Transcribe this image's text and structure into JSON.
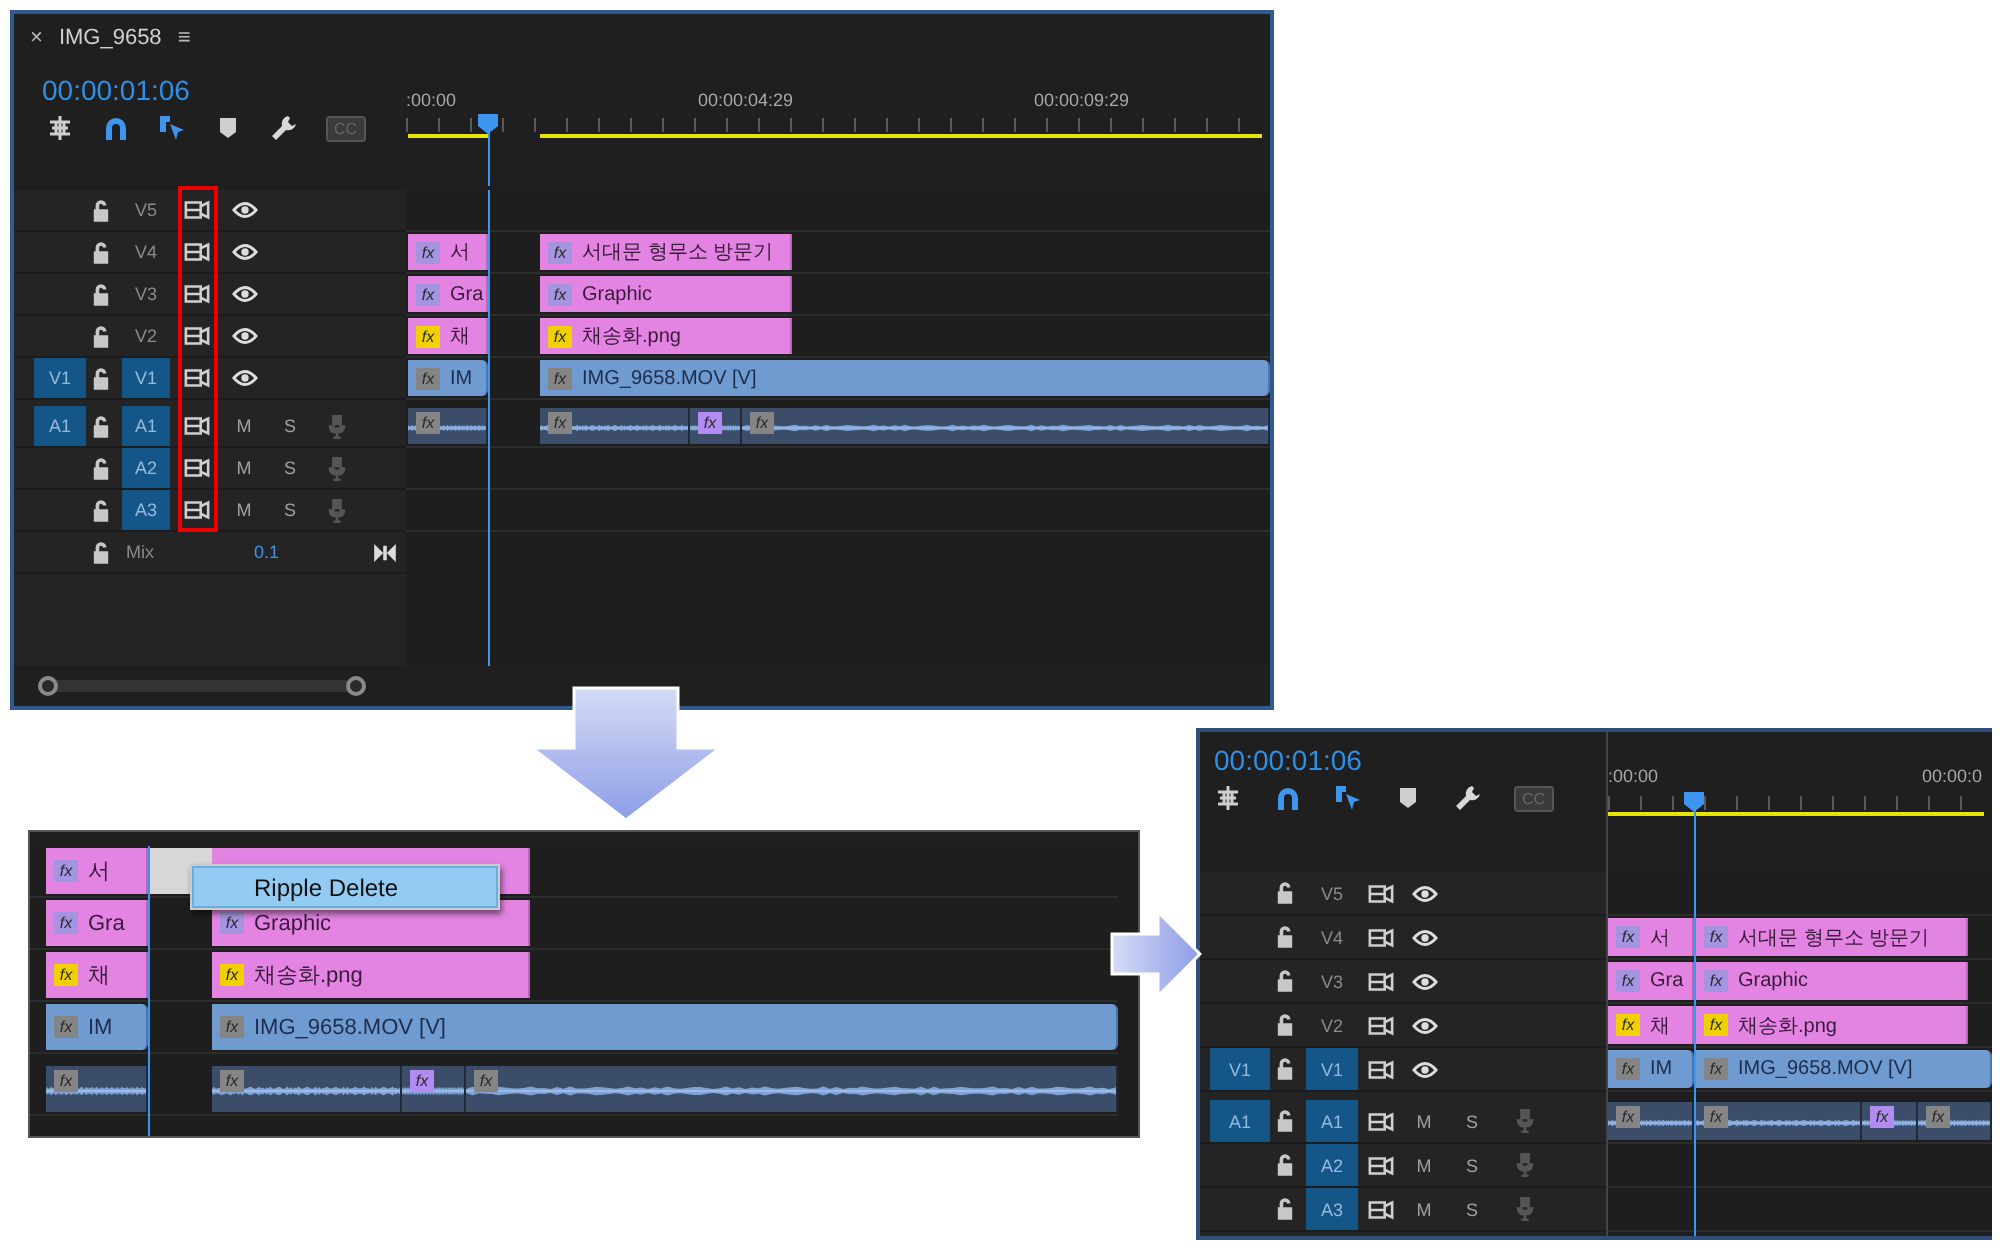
{
  "before": {
    "tab": {
      "close": "×",
      "title": "IMG_9658",
      "menu": "≡"
    },
    "timecode": "00:00:01:06",
    "captions": "CC",
    "ruler": [
      ":00:00",
      "00:00:04:29",
      "00:00:09:29"
    ],
    "tracks": [
      {
        "name": "V5",
        "kind": "video",
        "targeted": false
      },
      {
        "name": "V4",
        "kind": "video",
        "targeted": false,
        "clips": [
          {
            "kind": "graphic",
            "badge": "fx",
            "color": "#a595e0",
            "label": "서"
          },
          {
            "kind": "graphic",
            "badge": "fx",
            "color": "#a595e0",
            "label": "서대문 형무소 방문기"
          }
        ]
      },
      {
        "name": "V3",
        "kind": "video",
        "targeted": false,
        "clips": [
          {
            "kind": "graphic",
            "badge": "fx",
            "color": "#a595e0",
            "label": "Gra"
          },
          {
            "kind": "graphic",
            "badge": "fx",
            "color": "#a595e0",
            "label": "Graphic"
          }
        ]
      },
      {
        "name": "V2",
        "kind": "video",
        "targeted": false,
        "clips": [
          {
            "kind": "graphic",
            "badge": "fx",
            "color": "#f0d000",
            "label": "채"
          },
          {
            "kind": "graphic",
            "badge": "fx",
            "color": "#f0d000",
            "label": "채송화.png"
          }
        ]
      },
      {
        "name": "V1",
        "kind": "video",
        "source": "V1",
        "targeted": true,
        "clips": [
          {
            "kind": "video",
            "badge": "fx",
            "color": "#858585",
            "label": "IM"
          },
          {
            "kind": "video",
            "badge": "fx",
            "color": "#858585",
            "label": "IMG_9658.MOV [V]"
          }
        ]
      },
      {
        "name": "A1",
        "kind": "audio",
        "source": "A1",
        "targeted": true,
        "mute": "M",
        "solo": "S",
        "clips": [
          {
            "kind": "audio",
            "badge": "fx",
            "color": "#858585"
          },
          {
            "kind": "audio",
            "badge": "fx",
            "color": "#858585"
          },
          {
            "kind": "audio",
            "badge": "fx",
            "color": "#b28cf0"
          },
          {
            "kind": "audio",
            "badge": "fx",
            "color": "#858585"
          }
        ]
      },
      {
        "name": "A2",
        "kind": "audio",
        "targeted": true,
        "mute": "M",
        "solo": "S"
      },
      {
        "name": "A3",
        "kind": "audio",
        "targeted": true,
        "mute": "M",
        "solo": "S"
      }
    ],
    "mix": {
      "label": "Mix",
      "value": "0.1"
    }
  },
  "edit": {
    "tracks": [
      {
        "gap_selected": true,
        "clips": [
          {
            "kind": "graphic",
            "badge": "fx",
            "color": "#a595e0",
            "label": "서"
          },
          {
            "kind": "graphic"
          }
        ]
      },
      {
        "gap_selected": false,
        "clips": [
          {
            "kind": "graphic",
            "badge": "fx",
            "color": "#a595e0",
            "label": "Gra"
          },
          {
            "kind": "graphic",
            "badge": "fx",
            "color": "#a595e0",
            "label": "Graphic"
          }
        ]
      },
      {
        "gap_selected": false,
        "clips": [
          {
            "kind": "graphic",
            "badge": "fx",
            "color": "#f0d000",
            "label": "채"
          },
          {
            "kind": "graphic",
            "badge": "fx",
            "color": "#f0d000",
            "label": "채송화.png"
          }
        ]
      },
      {
        "gap_selected": false,
        "clips": [
          {
            "kind": "video",
            "badge": "fx",
            "color": "#858585",
            "label": "IM"
          },
          {
            "kind": "video",
            "badge": "fx",
            "color": "#858585",
            "label": "IMG_9658.MOV [V]"
          }
        ]
      },
      {
        "gap_selected": false,
        "clips": [
          {
            "kind": "audio",
            "badge": "fx",
            "color": "#858585"
          },
          {
            "kind": "audio",
            "badge": "fx",
            "color": "#858585"
          },
          {
            "kind": "audio",
            "badge": "fx",
            "color": "#b28cf0"
          },
          {
            "kind": "audio",
            "badge": "fx",
            "color": "#858585"
          }
        ]
      }
    ],
    "menu": [
      {
        "label": "Ripple Delete",
        "selected": true
      }
    ]
  },
  "after": {
    "timecode": "00:00:01:06",
    "captions": "CC",
    "ruler": [
      ":00:00",
      "00:00:0"
    ],
    "tracks": [
      {
        "name": "V5",
        "kind": "video",
        "targeted": false
      },
      {
        "name": "V4",
        "kind": "video",
        "targeted": false,
        "clips": [
          {
            "kind": "graphic",
            "badge": "fx",
            "color": "#a595e0",
            "label": "서"
          },
          {
            "kind": "graphic",
            "badge": "fx",
            "color": "#a595e0",
            "label": "서대문 형무소 방문기"
          }
        ]
      },
      {
        "name": "V3",
        "kind": "video",
        "targeted": false,
        "clips": [
          {
            "kind": "graphic",
            "badge": "fx",
            "color": "#a595e0",
            "label": "Gra"
          },
          {
            "kind": "graphic",
            "badge": "fx",
            "color": "#a595e0",
            "label": "Graphic"
          }
        ]
      },
      {
        "name": "V2",
        "kind": "video",
        "targeted": false,
        "clips": [
          {
            "kind": "graphic",
            "badge": "fx",
            "color": "#f0d000",
            "label": "채"
          },
          {
            "kind": "graphic",
            "badge": "fx",
            "color": "#f0d000",
            "label": "채송화.png"
          }
        ]
      },
      {
        "name": "V1",
        "kind": "video",
        "source": "V1",
        "targeted": true,
        "clips": [
          {
            "kind": "video",
            "badge": "fx",
            "color": "#858585",
            "label": "IM"
          },
          {
            "kind": "video",
            "badge": "fx",
            "color": "#858585",
            "label": "IMG_9658.MOV [V]"
          }
        ]
      },
      {
        "name": "A1",
        "kind": "audio",
        "source": "A1",
        "targeted": true,
        "mute": "M",
        "solo": "S",
        "clips": [
          {
            "kind": "audio",
            "badge": "fx",
            "color": "#858585"
          },
          {
            "kind": "audio",
            "badge": "fx",
            "color": "#858585"
          },
          {
            "kind": "audio",
            "badge": "fx",
            "color": "#b28cf0"
          },
          {
            "kind": "audio",
            "badge": "fx",
            "color": "#858585"
          }
        ]
      },
      {
        "name": "A2",
        "kind": "audio",
        "targeted": true,
        "mute": "M",
        "solo": "S"
      },
      {
        "name": "A3",
        "kind": "audio",
        "targeted": true,
        "mute": "M",
        "solo": "S"
      }
    ]
  }
}
